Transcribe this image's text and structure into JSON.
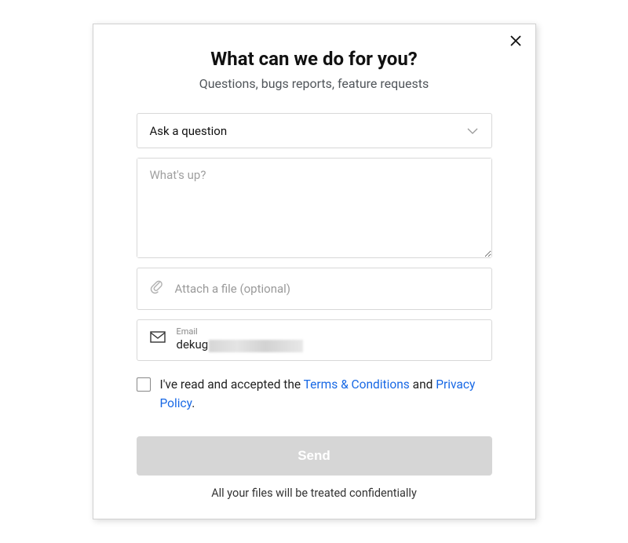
{
  "header": {
    "title": "What can we do for you?",
    "subtitle": "Questions, bugs reports, feature requests"
  },
  "form": {
    "topic_selected": "Ask a question",
    "message_placeholder": "What's up?",
    "attach_label": "Attach a file (optional)",
    "email_label": "Email",
    "email_value": "dekug"
  },
  "consent": {
    "prefix": "I've read and accepted the ",
    "terms_link": "Terms & Conditions",
    "middle": " and ",
    "privacy_link": "Privacy Policy",
    "suffix": "."
  },
  "actions": {
    "send_label": "Send"
  },
  "footer": {
    "confidential_note": "All your files will be treated confidentially"
  }
}
